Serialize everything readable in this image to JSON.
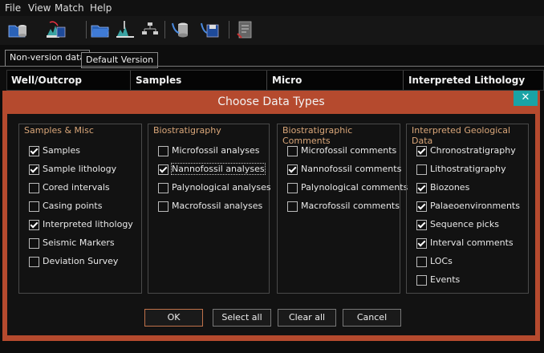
{
  "menu": [
    "File",
    "View",
    "Match",
    "Help"
  ],
  "toolbar_icons": [
    "open-database-icon",
    "import-data-icon",
    "open-folder-icon",
    "well-import-icon",
    "tree-icon",
    "export-database-icon",
    "save-export-icon",
    "report-icon"
  ],
  "tabs": [
    {
      "label": "Non-version data",
      "active": true
    },
    {
      "label": "Default Version",
      "active": false
    }
  ],
  "grid_columns": [
    "Well/Outcrop",
    "Samples",
    "Micro",
    "Interpreted Lithology"
  ],
  "dialog": {
    "title": "Choose Data Types",
    "close_label": "✕",
    "groups": [
      {
        "label": "Samples & Misc",
        "items": [
          {
            "label": "Samples",
            "checked": true
          },
          {
            "label": "Sample lithology",
            "checked": true
          },
          {
            "label": "Cored intervals",
            "checked": false
          },
          {
            "label": "Casing points",
            "checked": false
          },
          {
            "label": "Interpreted lithology",
            "checked": true
          },
          {
            "label": "Seismic Markers",
            "checked": false
          },
          {
            "label": "Deviation Survey",
            "checked": false
          }
        ]
      },
      {
        "label": "Biostratigraphy",
        "items": [
          {
            "label": "Microfossil analyses",
            "checked": false
          },
          {
            "label": "Nannofossil analyses",
            "checked": true,
            "focused": true
          },
          {
            "label": "Palynological analyses",
            "checked": false
          },
          {
            "label": "Macrofossil analyses",
            "checked": false
          }
        ]
      },
      {
        "label": "Biostratigraphic Comments",
        "items": [
          {
            "label": "Microfossil comments",
            "checked": false
          },
          {
            "label": "Nannofossil comments",
            "checked": true
          },
          {
            "label": "Palynological comments",
            "checked": false
          },
          {
            "label": "Macrofossil comments",
            "checked": false
          }
        ]
      },
      {
        "label": "Interpreted Geological Data",
        "items": [
          {
            "label": "Chronostratigraphy",
            "checked": true
          },
          {
            "label": "Lithostratigraphy",
            "checked": false
          },
          {
            "label": "Biozones",
            "checked": true
          },
          {
            "label": "Palaeoenvironments",
            "checked": true
          },
          {
            "label": "Sequence picks",
            "checked": true
          },
          {
            "label": "Interval comments",
            "checked": true
          },
          {
            "label": "LOCs",
            "checked": false
          },
          {
            "label": "Events",
            "checked": false
          }
        ]
      }
    ],
    "buttons": {
      "ok": "OK",
      "select_all": "Select all",
      "clear_all": "Clear all",
      "cancel": "Cancel"
    }
  },
  "colors": {
    "dialog_frame": "#b54a2e",
    "close_button": "#1aa3a6",
    "group_label": "#d9a679",
    "background": "#0d0d0d"
  }
}
